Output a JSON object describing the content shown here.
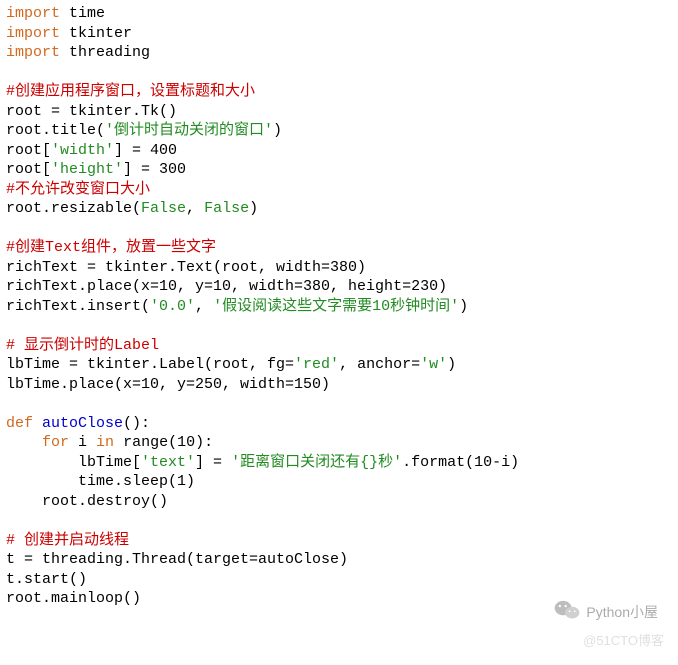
{
  "code": {
    "l1a": "import",
    "l1b": " time",
    "l2a": "import",
    "l2b": " tkinter",
    "l3a": "import",
    "l3b": " threading",
    "c1": "#创建应用程序窗口，设置标题和大小",
    "l5": "root = tkinter.Tk()",
    "l6a": "root.title(",
    "l6b": "'倒计时自动关闭的窗口'",
    "l6c": ")",
    "l7a": "root[",
    "l7b": "'width'",
    "l7c": "] = 400",
    "l8a": "root[",
    "l8b": "'height'",
    "l8c": "] = 300",
    "c2": "#不允许改变窗口大小",
    "l10a": "root.resizable(",
    "l10b": "False",
    "l10c": ", ",
    "l10d": "False",
    "l10e": ")",
    "c3": "#创建Text组件，放置一些文字",
    "l12": "richText = tkinter.Text(root, width=380)",
    "l13": "richText.place(x=10, y=10, width=380, height=230)",
    "l14a": "richText.insert(",
    "l14b": "'0.0'",
    "l14c": ", ",
    "l14d": "'假设阅读这些文字需要10秒钟时间'",
    "l14e": ")",
    "c4": "# 显示倒计时的Label",
    "l16a": "lbTime = tkinter.Label(root, fg=",
    "l16b": "'red'",
    "l16c": ", anchor=",
    "l16d": "'w'",
    "l16e": ")",
    "l17": "lbTime.place(x=10, y=250, width=150)",
    "l19a": "def",
    "l19b": " ",
    "l19c": "autoClose",
    "l19d": "():",
    "l20a": "    ",
    "l20b": "for",
    "l20c": " i ",
    "l20d": "in",
    "l20e": " range(10):",
    "l21a": "        lbTime[",
    "l21b": "'text'",
    "l21c": "] = ",
    "l21d": "'距离窗口关闭还有{}秒'",
    "l21e": ".format(10-i)",
    "l22": "        time.sleep(1)",
    "l23": "    root.destroy()",
    "c5": "# 创建并启动线程",
    "l25": "t = threading.Thread(target=autoClose)",
    "l26": "t.start()",
    "l27": "root.mainloop()"
  },
  "watermark": "Python小屋",
  "faint": "@51CTO博客"
}
